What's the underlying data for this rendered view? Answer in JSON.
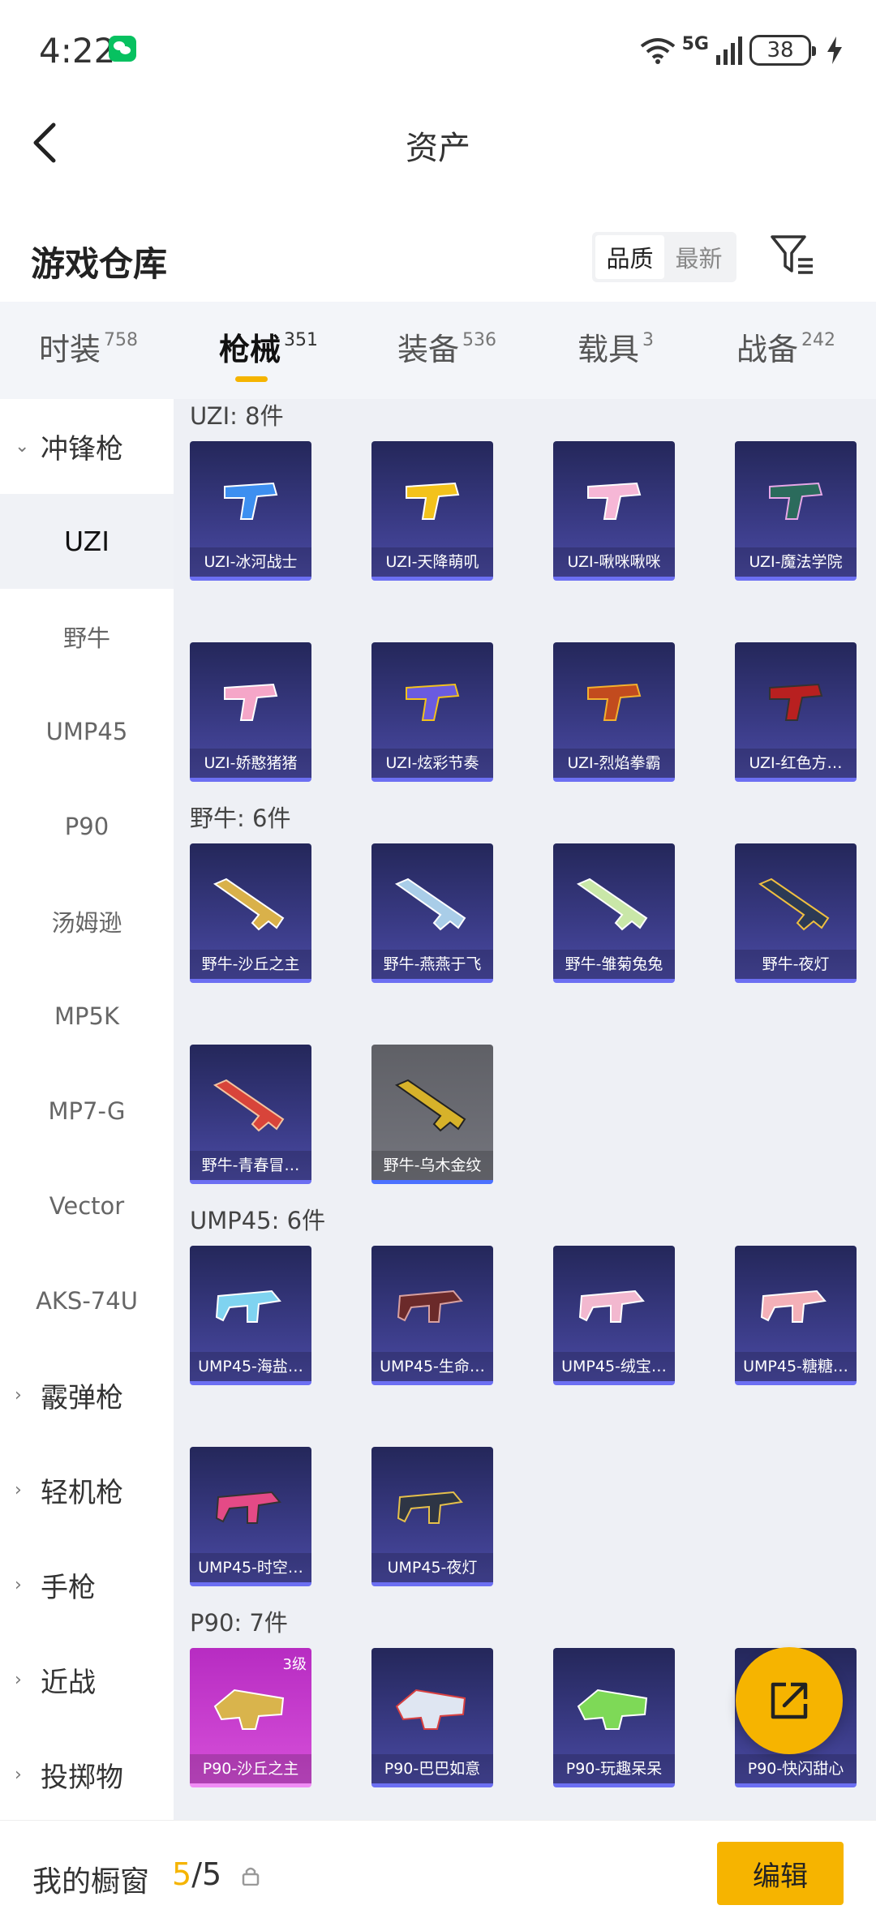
{
  "status": {
    "time": "4:22",
    "network": "5G",
    "battery": "38"
  },
  "header": {
    "title": "资产"
  },
  "section": {
    "title": "游戏仓库",
    "sort_options": [
      "品质",
      "最新"
    ]
  },
  "tabs": [
    {
      "label": "时装",
      "count": "758"
    },
    {
      "label": "枪械",
      "count": "351"
    },
    {
      "label": "装备",
      "count": "536"
    },
    {
      "label": "载具",
      "count": "3"
    },
    {
      "label": "战备",
      "count": "242"
    }
  ],
  "sidebar": {
    "group_open": "冲锋枪",
    "items": [
      "UZI",
      "野牛",
      "UMP45",
      "P90",
      "汤姆逊",
      "MP5K",
      "MP7-G",
      "Vector",
      "AKS-74U"
    ],
    "groups_closed": [
      "霰弹枪",
      "轻机枪",
      "手枪",
      "近战",
      "投掷物"
    ]
  },
  "groups": [
    {
      "title": "UZI: 8件",
      "items": [
        "UZI-冰河战士",
        "UZI-天降萌叽",
        "UZI-啾咪啾咪",
        "UZI-魔法学院",
        "UZI-娇憨猪猪",
        "UZI-炫彩节奏",
        "UZI-烈焰拳霸",
        "UZI-红色方…"
      ]
    },
    {
      "title": "野牛: 6件",
      "items": [
        "野牛-沙丘之主",
        "野牛-燕燕于飞",
        "野牛-雏菊兔兔",
        "野牛-夜灯",
        "野牛-青春冒…",
        "野牛-乌木金纹"
      ]
    },
    {
      "title": "UMP45: 6件",
      "items": [
        "UMP45-海盐…",
        "UMP45-生命…",
        "UMP45-绒宝…",
        "UMP45-糖糖…",
        "UMP45-时空…",
        "UMP45-夜灯"
      ]
    },
    {
      "title": "P90: 7件",
      "items": [
        "P90-沙丘之主",
        "P90-巴巴如意",
        "P90-玩趣呆呆",
        "P90-快闪甜心"
      ],
      "first_level": "3级"
    }
  ],
  "bottom": {
    "label": "我的橱窗",
    "current": "5",
    "total": "/5",
    "edit_label": "编辑"
  },
  "colors": {
    "accent": "#f6b400",
    "card_bg": "#3a3b86",
    "content_bg": "#eef0f5"
  }
}
